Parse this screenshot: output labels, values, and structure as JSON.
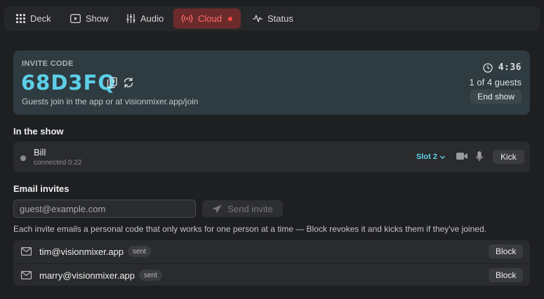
{
  "nav": {
    "tabs": [
      {
        "label": "Deck",
        "icon": "grid-icon"
      },
      {
        "label": "Show",
        "icon": "play-window-icon"
      },
      {
        "label": "Audio",
        "icon": "sliders-icon"
      },
      {
        "label": "Cloud",
        "icon": "broadcast-icon",
        "active": true,
        "indicator": "live-dot"
      },
      {
        "label": "Status",
        "icon": "pulse-icon"
      }
    ]
  },
  "invite": {
    "label": "INVITE CODE",
    "code": "68D3FQ",
    "hint": "Guests join in the app or at visionmixer.app/join",
    "timer": "4:36",
    "guests": "1 of 4 guests",
    "end_label": "End show"
  },
  "show": {
    "title": "In the show",
    "participant": {
      "name": "Bill",
      "status": "connected 0:22",
      "slot": "Slot 2",
      "kick_label": "Kick"
    }
  },
  "email": {
    "title": "Email invites",
    "placeholder": "guest@example.com",
    "value": "",
    "send_label": "Send invite",
    "note": "Each invite emails a personal code that only works for one person at a time — Block revokes it and kicks them if they've joined.",
    "invites": [
      {
        "email": "tim@visionmixer.app",
        "status": "sent",
        "block_label": "Block"
      },
      {
        "email": "marry@visionmixer.app",
        "status": "sent",
        "block_label": "Block"
      }
    ]
  },
  "colors": {
    "accent": "#5ccfe6",
    "live_red": "#ff4545",
    "active_tab_bg": "#6b2b2b",
    "background": "#1e1f21"
  }
}
